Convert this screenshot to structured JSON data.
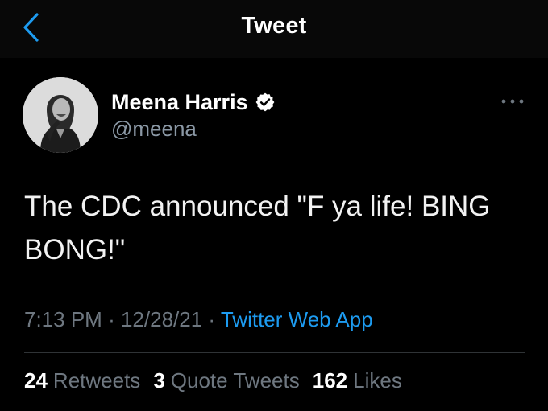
{
  "header": {
    "title": "Tweet",
    "back_icon": "chevron-left-icon",
    "accent_color": "#1d9bf0"
  },
  "author": {
    "display_name": "Meena Harris",
    "handle": "@meena",
    "verified": true,
    "verified_icon": "verified-badge-icon",
    "avatar_icon": "avatar-photo"
  },
  "more_icon": "more-options-icon",
  "tweet": {
    "text": "The CDC announced \"F ya life! BING BONG!\""
  },
  "meta": {
    "time": "7:13 PM",
    "separator": "·",
    "date": "12/28/21",
    "source": "Twitter Web App"
  },
  "stats": {
    "retweets_count": "24",
    "retweets_label": "Retweets",
    "quotes_count": "3",
    "quotes_label": "Quote Tweets",
    "likes_count": "162",
    "likes_label": "Likes"
  }
}
